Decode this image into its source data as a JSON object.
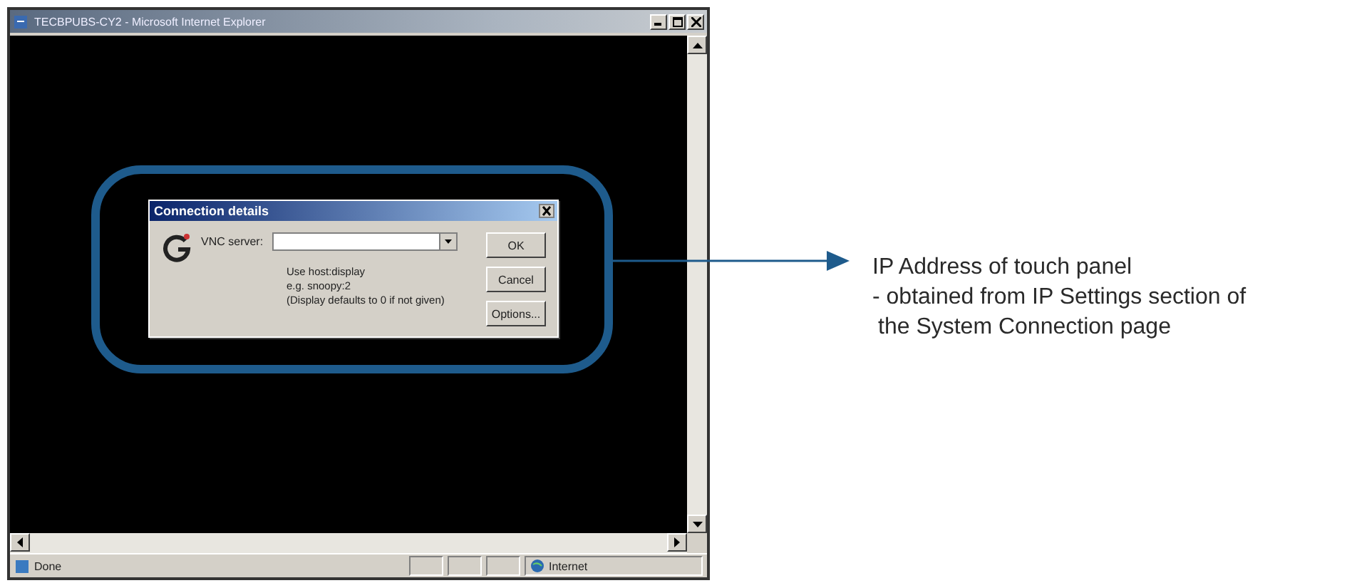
{
  "window": {
    "title": "TECBPUBS-CY2 - Microsoft Internet Explorer"
  },
  "dialog": {
    "title": "Connection details",
    "field_label": "VNC server:",
    "hint_lines": [
      "Use host:display",
      "e.g. snoopy:2",
      "(Display defaults to 0 if not given)"
    ],
    "buttons": [
      "OK",
      "Cancel",
      "Options..."
    ]
  },
  "status_bar": {
    "status": "Done",
    "zone": "Internet"
  },
  "annotation": {
    "lines": [
      "IP Address of touch panel",
      "- obtained from IP Settings section of",
      "the System Connection page"
    ]
  }
}
